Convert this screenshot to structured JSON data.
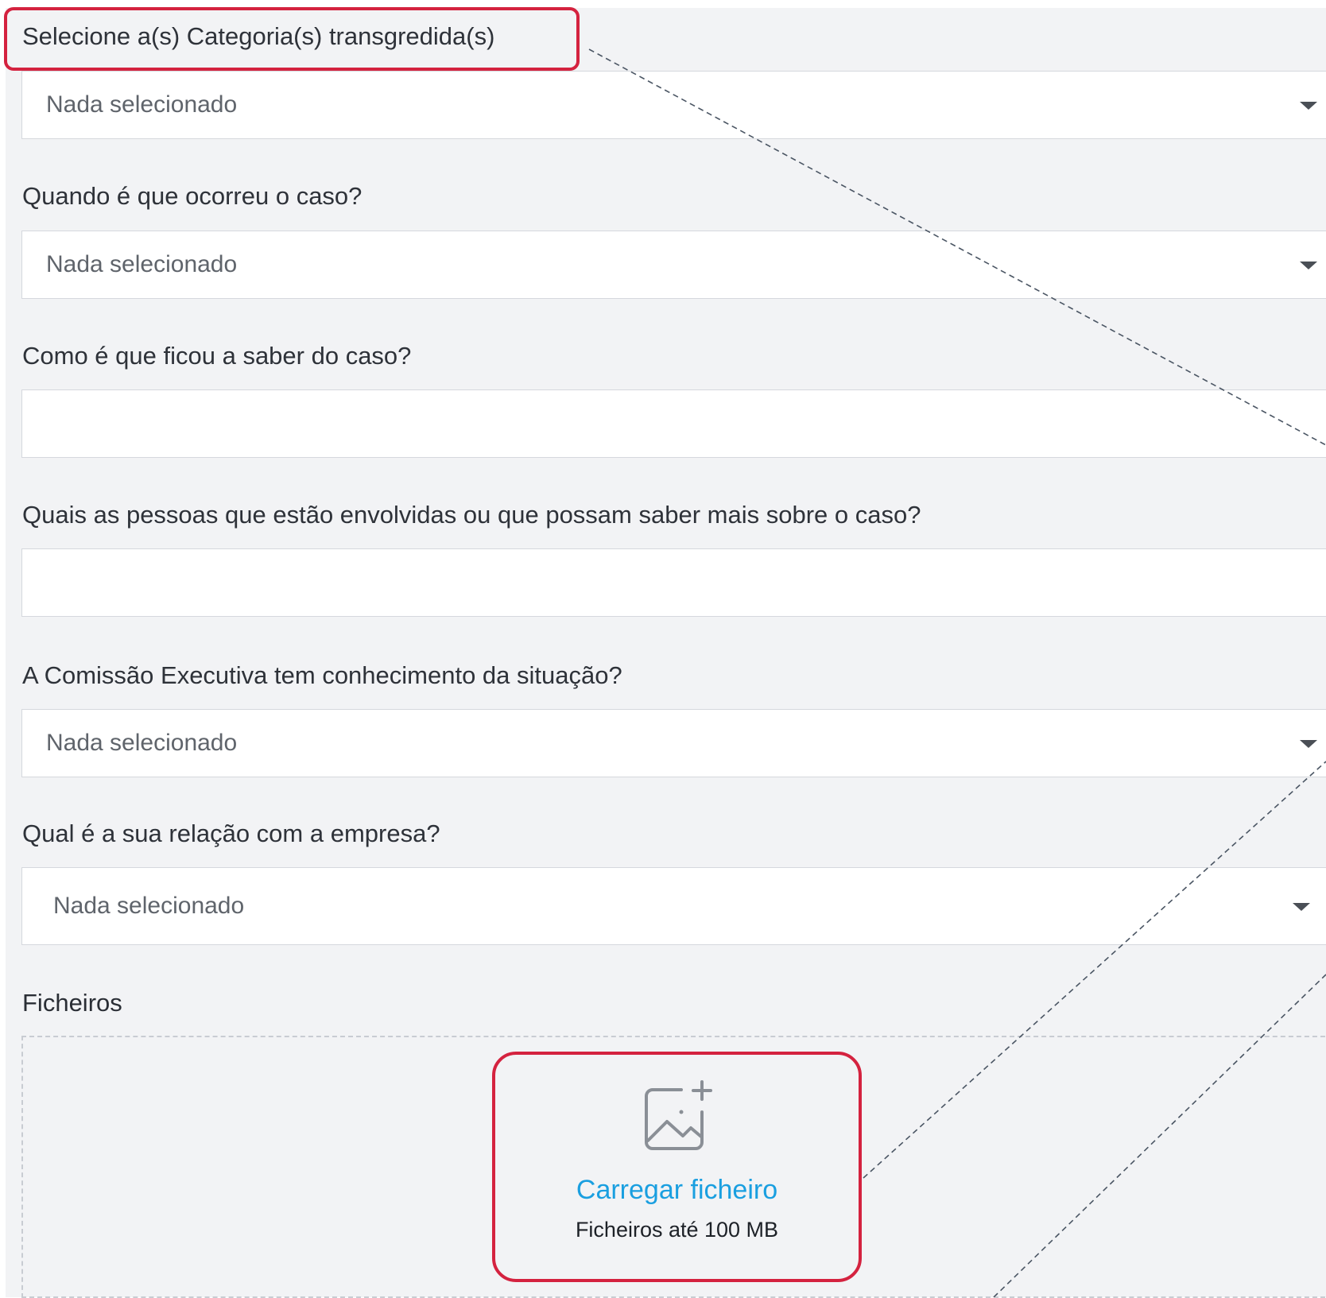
{
  "form": {
    "categories": {
      "label": "Selecione a(s) Categoria(s) transgredida(s)",
      "value": "Nada selecionado"
    },
    "when": {
      "label": "Quando é que ocorreu o caso?",
      "value": "Nada selecionado"
    },
    "how_known": {
      "label": "Como é que ficou a saber do caso?",
      "value": ""
    },
    "people": {
      "label": "Quais as pessoas que estão envolvidas ou que possam saber mais sobre o caso?",
      "value": ""
    },
    "committee": {
      "label": "A Comissão Executiva tem conhecimento da situação?",
      "value": "Nada selecionado"
    },
    "relation": {
      "label": "Qual é a sua relação com a empresa?",
      "value": "Nada selecionado"
    },
    "files": {
      "label": "Ficheiros",
      "upload_link": "Carregar ficheiro",
      "upload_hint": "Ficheiros até 100 MB",
      "icon": "image-add-icon"
    }
  },
  "colors": {
    "highlight": "#d4223f",
    "link": "#1a9fe0",
    "panel_background": "#f2f3f5"
  }
}
